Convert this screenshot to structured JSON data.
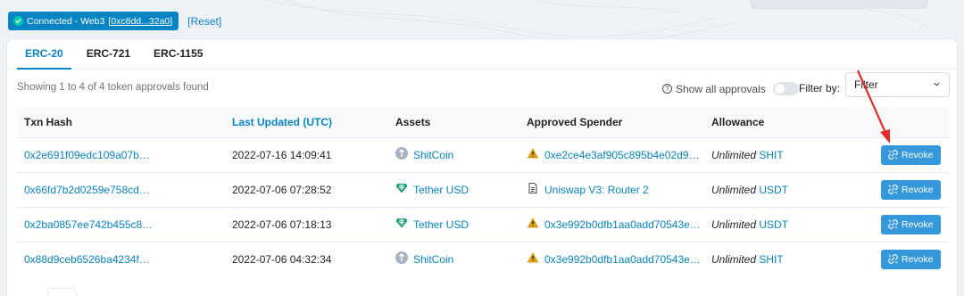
{
  "connection": {
    "status_text": "Connected - Web3",
    "address": "[0xc8dd...32a0]",
    "reset_label": "[Reset]"
  },
  "tabs": [
    {
      "label": "ERC-20",
      "active": true
    },
    {
      "label": "ERC-721",
      "active": false
    },
    {
      "label": "ERC-1155",
      "active": false
    }
  ],
  "summary": "Showing 1 to 4 of 4 token approvals found",
  "show_all_label": "Show all approvals",
  "show_all_enabled": false,
  "filter": {
    "label": "Filter by:",
    "value": "Filter"
  },
  "table": {
    "columns": [
      "Txn Hash",
      "Last Updated (UTC)",
      "Assets",
      "Approved Spender",
      "Allowance",
      ""
    ],
    "rows": [
      {
        "txn_hash": "0x2e691f09edc109a07b…",
        "updated": "2022-07-16 14:09:41",
        "asset": "ShitCoin",
        "asset_icon": "coin-icon",
        "spender": "0xe2ce4e3af905c895b4e02d954f…",
        "spender_icon": "warning-icon",
        "allowance_type": "Unlimited",
        "allowance_token": "SHIT",
        "revoke_label": "Revoke"
      },
      {
        "txn_hash": "0x66fd7b2d0259e758cd…",
        "updated": "2022-07-06 07:28:52",
        "asset": "Tether USD",
        "asset_icon": "tether-icon",
        "spender": "Uniswap V3: Router 2",
        "spender_icon": "document-icon",
        "allowance_type": "Unlimited",
        "allowance_token": "USDT",
        "revoke_label": "Revoke"
      },
      {
        "txn_hash": "0x2ba0857ee742b455c8…",
        "updated": "2022-07-06 07:18:13",
        "asset": "Tether USD",
        "asset_icon": "tether-icon",
        "spender": "0x3e992b0dfb1aa0add70543ed0…",
        "spender_icon": "warning-icon",
        "allowance_type": "Unlimited",
        "allowance_token": "USDT",
        "revoke_label": "Revoke"
      },
      {
        "txn_hash": "0x88d9ceb6526ba4234f…",
        "updated": "2022-07-06 04:32:34",
        "asset": "ShitCoin",
        "asset_icon": "coin-icon",
        "spender": "0x3e992b0dfb1aa0add70543ed0…",
        "spender_icon": "warning-icon",
        "allowance_type": "Unlimited",
        "allowance_token": "SHIT",
        "revoke_label": "Revoke"
      }
    ]
  },
  "colors": {
    "accent": "#0784c3",
    "revoke_button": "#3498db",
    "warning": "#dba11a",
    "tether": "#26a17b",
    "annotation_arrow": "#e32b2b"
  }
}
